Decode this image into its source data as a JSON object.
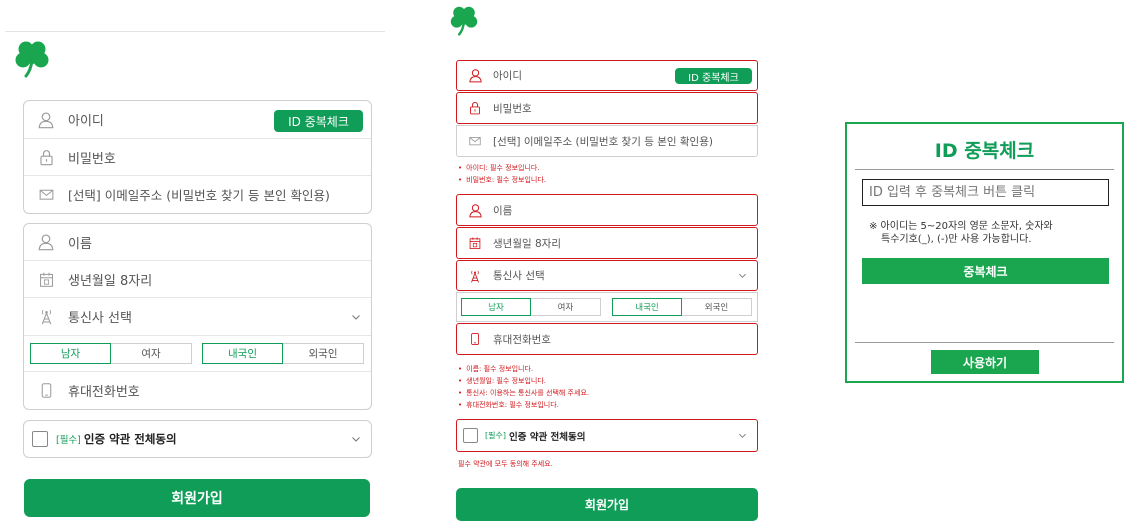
{
  "signup": {
    "id_placeholder": "아이디",
    "id_check_button": "ID 중복체크",
    "password_placeholder": "비밀번호",
    "email_placeholder": "[선택] 이메일주소 (비밀번호 찾기 등 본인 확인용)",
    "name_placeholder": "이름",
    "birth_placeholder": "생년월일 8자리",
    "carrier_placeholder": "통신사 선택",
    "gender_male": "남자",
    "gender_female": "여자",
    "nation_domestic": "내국인",
    "nation_foreign": "외국인",
    "phone_placeholder": "휴대전화번호",
    "terms_required_tag": "[필수]",
    "terms_label": "인증 약관 전체동의",
    "submit_label": "회원가입"
  },
  "errors": {
    "group1": [
      "아이디: 필수 정보입니다.",
      "비밀번호: 필수 정보입니다."
    ],
    "group2": [
      "이름: 필수 정보입니다.",
      "생년월일: 필수 정보입니다.",
      "통신사: 이용하는 통신사를 선택해 주세요.",
      "휴대전화번호: 필수 정보입니다."
    ],
    "terms": "필수 약관에 모두 동의해 주세요."
  },
  "modal": {
    "title": "ID 중복체크",
    "input_placeholder": "ID 입력 후 중복체크 버튼 클릭",
    "note_line1": "※ 아이디는 5~20자의 영문 소문자, 숫자와",
    "note_line2": "특수기호(_), (-)만 사용 가능합니다.",
    "check_button": "중복체크",
    "use_button": "사용하기"
  },
  "colors": {
    "brand_green": "#0f9d58",
    "error_red": "#d0181d",
    "modal_border": "#1aa64f"
  },
  "icons": [
    "clover-logo-icon",
    "user-icon",
    "lock-icon",
    "envelope-icon",
    "calendar-icon",
    "antenna-icon",
    "phone-icon",
    "chevron-down-icon"
  ]
}
